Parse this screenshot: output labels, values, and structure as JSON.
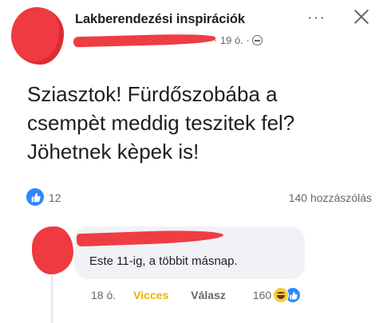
{
  "post": {
    "group_name": "Lakberendezési inspirációk",
    "time": "· 19 ó. ·",
    "audience_icon": "globe-icon",
    "text": "Sziasztok! Fürdőszobába a\ncsempèt meddig teszitek fel?\nJöhetnek kèpek is!",
    "like_count": "12",
    "comment_count": "140 hozzászólás"
  },
  "header": {
    "more_label": "···",
    "close_icon": "close-icon"
  },
  "comment": {
    "text": "Este 11-ig, a többit másnap.",
    "time": "18 ó.",
    "reaction_label": "Vicces",
    "reply_label": "Válasz",
    "reaction_count": "160",
    "reaction_icons": [
      "haha-icon",
      "like-icon"
    ]
  },
  "colors": {
    "accent_blue": "#2d88ff",
    "reaction_yellow": "#e9b300",
    "redaction_red": "#ef3d44",
    "muted_text": "#65676b",
    "bubble_bg": "#f0f2f5"
  }
}
